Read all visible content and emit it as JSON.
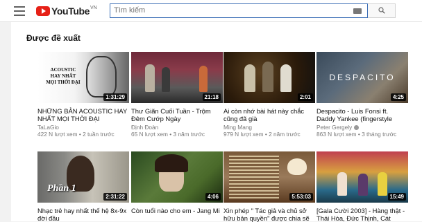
{
  "header": {
    "logo_text": "YouTube",
    "logo_region": "VN",
    "search_placeholder": "Tìm kiếm"
  },
  "section": {
    "title": "Được đề xuất"
  },
  "videos": [
    {
      "title": "NHỮNG BẢN ACOUSTIC HAY NHẤT MỌI THỜI ĐẠI",
      "channel": "TaLaGio",
      "meta": "422 N lượt xem • 2 tuần trước",
      "duration": "1:31:29",
      "thumb_text": "ACOUSTIC\nHAY NHẤT\nMỌI THỜI ĐẠI"
    },
    {
      "title": "Thư Giãn Cuối Tuần - Trộm Đêm Cướp Ngày",
      "channel": "Định Đoàn",
      "meta": "65 N lượt xem • 3 năm trước",
      "duration": "21:18"
    },
    {
      "title": "Ai còn nhớ bài hát này chắc cũng đã già",
      "channel": "Ming Mang",
      "meta": "979 N lượt xem • 2 năm trước",
      "duration": "2:01"
    },
    {
      "title": "Despacito - Luis Fonsi ft. Daddy Yankee (fingerstyle",
      "channel": "Peter Gergely",
      "meta": "863 N lượt xem • 3 tháng trước",
      "duration": "4:25",
      "thumb_text": "DESPACITO"
    },
    {
      "title": "Nhạc trẻ hay nhất thế hệ 8x-9x đời đầu",
      "channel": "",
      "meta": "",
      "duration": "2:31:22",
      "thumb_text": "Phần 1"
    },
    {
      "title": "Còn tuổi nào cho em - Jang Mi",
      "channel": "",
      "meta": "",
      "duration": "4:06"
    },
    {
      "title": "Xin phép \" Tác giả và chủ sở hữu bản quyền\" được chia sẽ",
      "channel": "",
      "meta": "",
      "duration": "5:53:03"
    },
    {
      "title": "[Gala Cười 2003] - Hàng thật - Thái Hòa, Đức Thịnh, Cát",
      "channel": "",
      "meta": "",
      "duration": "15:49"
    }
  ],
  "colors": {
    "logo_red": "#e62117",
    "search_border": "#3b6db5"
  }
}
